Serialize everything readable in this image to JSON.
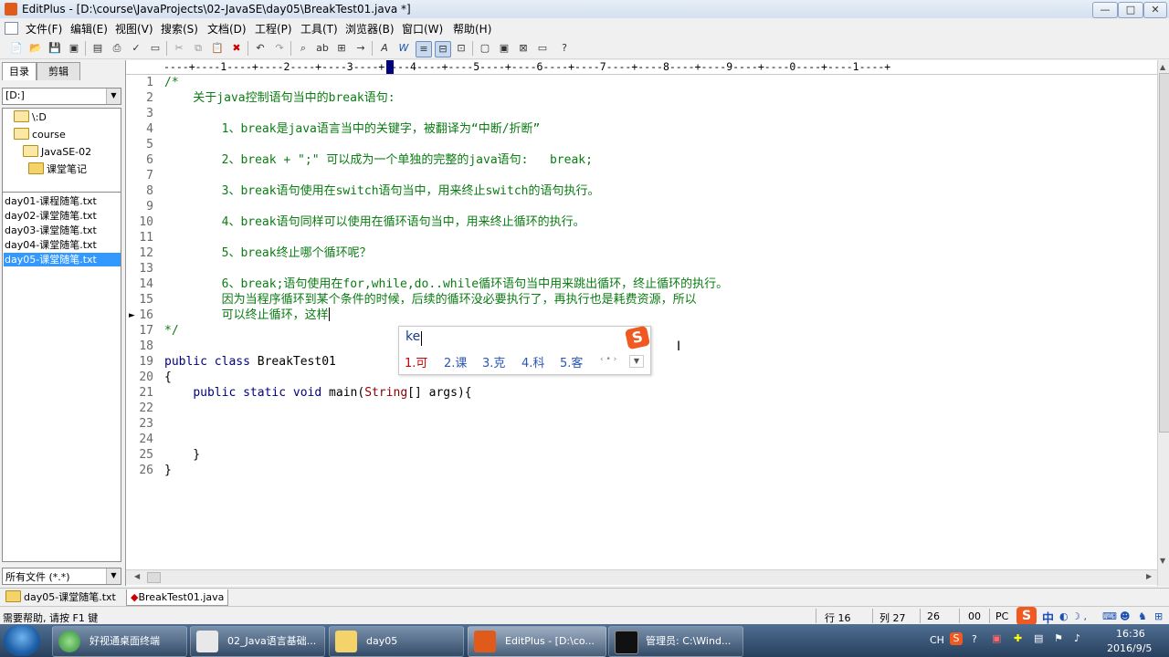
{
  "window": {
    "title": "EditPlus - [D:\\course\\JavaProjects\\02-JavaSE\\day05\\BreakTest01.java *]",
    "controls": {
      "minimize": "—",
      "maximize": "□",
      "close": "✕"
    }
  },
  "menu": [
    "文件(F)",
    "编辑(E)",
    "视图(V)",
    "搜索(S)",
    "文档(D)",
    "工程(P)",
    "工具(T)",
    "浏览器(B)",
    "窗口(W)",
    "帮助(H)"
  ],
  "left_panel": {
    "tabs": [
      "目录",
      "剪辑"
    ],
    "drive": "[D:]",
    "folders": [
      "\\:D",
      "course",
      "JavaSE-02",
      "课堂笔记"
    ],
    "files": [
      "day01-课程随笔.txt",
      "day02-课堂随笔.txt",
      "day03-课堂随笔.txt",
      "day04-课堂随笔.txt",
      "day05-课堂随笔.txt"
    ],
    "selected_file_index": 4,
    "filter": "所有文件 (*.*)"
  },
  "ruler": "----+----1----+----2----+----3----+----4----+----5----+----6----+----7----+----8----+----9----+----0----+----1----+",
  "editor": {
    "lines": [
      "1",
      "2",
      "3",
      "4",
      "5",
      "6",
      "7",
      "8",
      "9",
      "10",
      "11",
      "12",
      "13",
      "14",
      "15",
      "16",
      "17",
      "18",
      "19",
      "20",
      "21",
      "22",
      "23",
      "24",
      "25",
      "26"
    ],
    "code": {
      "l1": "/*",
      "l2": "    关于java控制语句当中的break语句:",
      "l4": "        1、break是java语言当中的关键字，被翻译为“中断/折断”",
      "l6": "        2、break + \";\" 可以成为一个单独的完整的java语句:   break;",
      "l8": "        3、break语句使用在switch语句当中，用来终止switch的语句执行。",
      "l10": "        4、break语句同样可以使用在循环语句当中，用来终止循环的执行。",
      "l12": "        5、break终止哪个循环呢？",
      "l14": "        6、break;语句使用在for,while,do..while循环语句当中用来跳出循环，终止循环的执行。",
      "l15": "        因为当程序循环到某个条件的时候，后续的循环没必要执行了，再执行也是耗费资源，所以",
      "l16": "        可以终止循环，这样",
      "l17": "*/",
      "l19_kw1": "public",
      "l19_kw2": "class",
      "l19_name": "BreakTest01",
      "l20": "{",
      "l21_kw1": "public",
      "l21_kw2": "static",
      "l21_kw3": "void",
      "l21_main": "main(",
      "l21_type": "String",
      "l21_rest": "[] args){",
      "l25": "    }",
      "l26": "}"
    },
    "current_line": 16
  },
  "ime": {
    "composition": "ke",
    "candidates": [
      "1.可",
      "2.课",
      "3.克",
      "4.科",
      "5.客"
    ],
    "logo": "S"
  },
  "doc_tabs": [
    "day05-课堂随笔.txt",
    "BreakTest01.java"
  ],
  "status": {
    "help": "需要帮助, 请按 F1 键",
    "row": "行 16",
    "col": "列 27",
    "num1": "26",
    "num2": "00",
    "mode": "PC"
  },
  "taskbar": {
    "buttons": [
      "好视通桌面终端",
      "02_Java语言基础...",
      "day05",
      "EditPlus - [D:\\co...",
      "管理员: C:\\Wind..."
    ],
    "time": "16:36",
    "date": "2016/9/5",
    "ime_lang": "中",
    "lang_code": "CH"
  }
}
